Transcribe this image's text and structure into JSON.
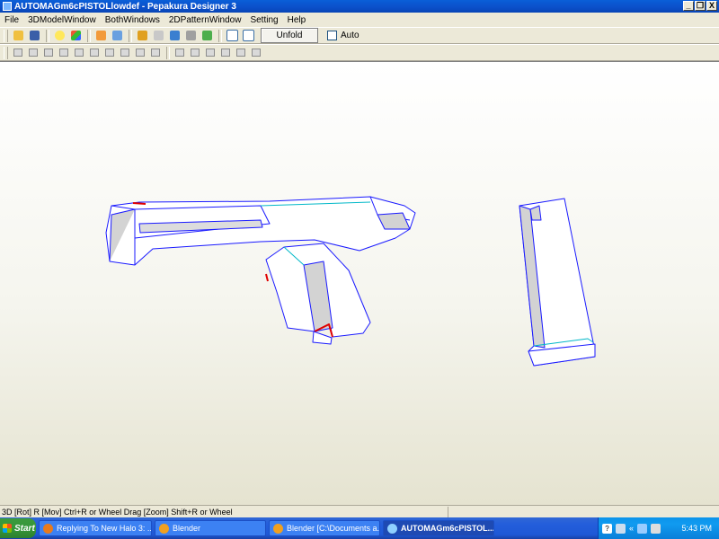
{
  "window": {
    "title": "AUTOMAGm6cPISTOLlowdef - Pepakura Designer 3",
    "minimize": "_",
    "restore": "̱",
    "close": "X"
  },
  "menu": [
    "File",
    "3DModelWindow",
    "BothWindows",
    "2DPatternWindow",
    "Setting",
    "Help"
  ],
  "toolbar": {
    "unfold_label": "Unfold",
    "auto_label": "Auto"
  },
  "status": {
    "hint": "3D [Rot] R [Mov] Ctrl+R or Wheel Drag [Zoom] Shift+R or Wheel"
  },
  "taskbar": {
    "start_label": "Start",
    "tasks": [
      "Replying To New Halo 3: ...",
      "Blender",
      "Blender [C:\\Documents a...",
      "AUTOMAGm6cPISTOL..."
    ],
    "help_icon": "?",
    "chevron": "«",
    "clock": "5:43 PM"
  },
  "colors": {
    "model_edge": "#1a1aff",
    "fold_edge": "#00b8c8",
    "cut_edge": "#e00000",
    "shaded_face": "#d3d3d3"
  }
}
